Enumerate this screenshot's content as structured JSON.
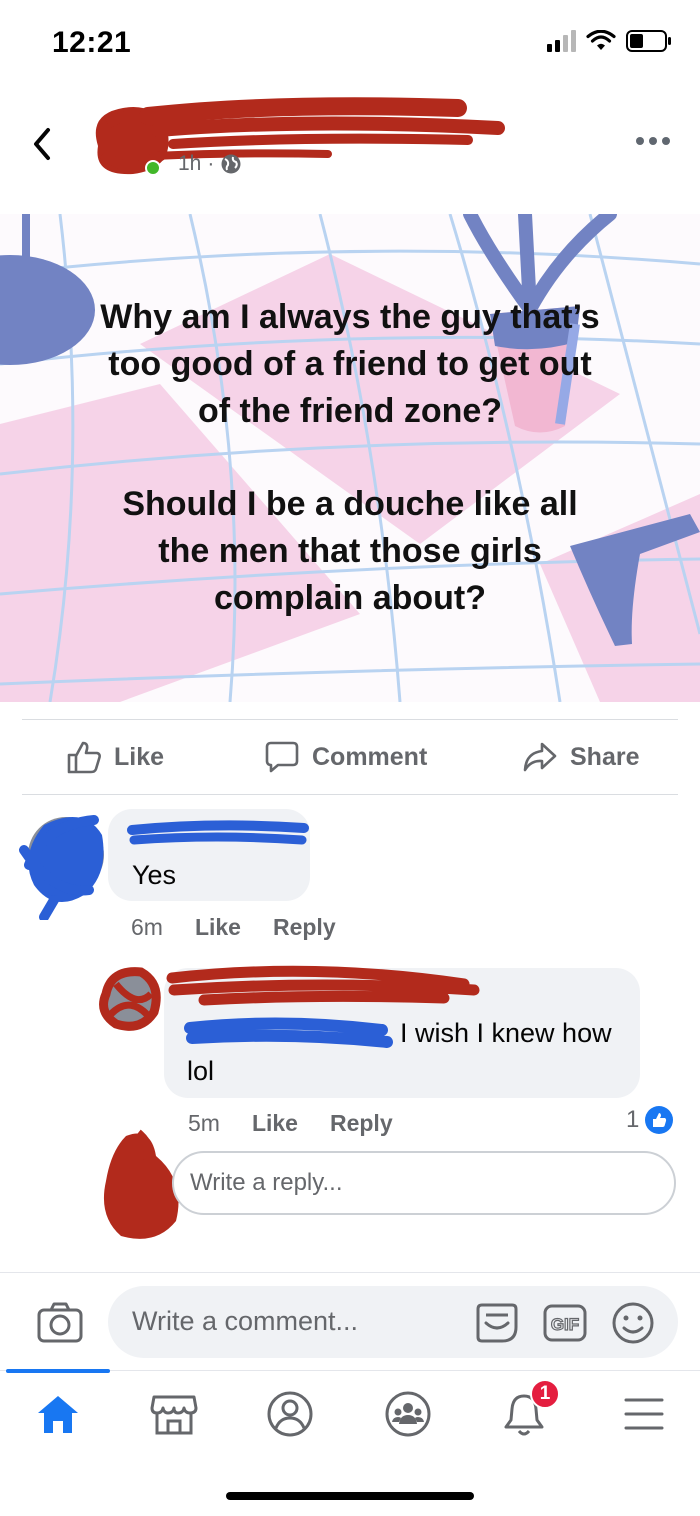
{
  "status_bar": {
    "time": "12:21"
  },
  "post": {
    "meta_time": "1h",
    "meta_separator": "·",
    "image_text_line1": "Why am I always the guy that’s",
    "image_text_line2": "too good of a friend to get out",
    "image_text_line3": "of the friend zone?",
    "image_text_line4": "Should I be a douche like all",
    "image_text_line5": "the men that those girls",
    "image_text_line6": "complain about?"
  },
  "actions": {
    "like": "Like",
    "comment": "Comment",
    "share": "Share"
  },
  "comments": [
    {
      "text": "Yes",
      "time": "6m",
      "like": "Like",
      "reply": "Reply"
    },
    {
      "text_line1": "I wish I knew how",
      "text_line2": "lol",
      "time": "5m",
      "like": "Like",
      "reply": "Reply",
      "reaction_count": "1"
    }
  ],
  "reply_box": {
    "placeholder": "Write a reply..."
  },
  "composer": {
    "placeholder": "Write a comment...",
    "gif_label": "GIF"
  },
  "tab_bar": {
    "notification_count": "1"
  },
  "colors": {
    "facebook_blue": "#1877f2",
    "redact_red": "#b22a1c",
    "redact_blue": "#2b5fd6",
    "badge_red": "#e41e3f",
    "muted_text": "#65676b",
    "bubble_bg": "#f0f2f5"
  },
  "icons": [
    "back-chevron-icon",
    "more-icon",
    "globe-icon",
    "like-thumb-icon",
    "comment-icon",
    "share-icon",
    "camera-icon",
    "sticker-icon",
    "gif-icon",
    "emoji-icon",
    "home-icon",
    "marketplace-icon",
    "profile-icon",
    "groups-icon",
    "bell-icon",
    "menu-icon"
  ]
}
